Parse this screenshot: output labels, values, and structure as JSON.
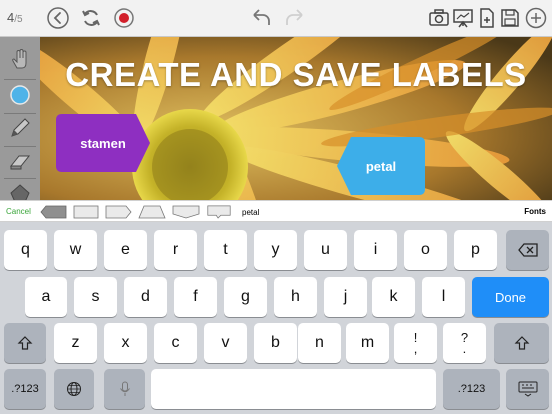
{
  "toolbar": {
    "page_current": "4",
    "page_total": "/5",
    "icons": [
      "back-circle-icon",
      "refresh-icon",
      "record-icon",
      "undo-icon",
      "redo-icon",
      "camera-icon",
      "presentation-icon",
      "export-icon",
      "save-icon",
      "add-icon"
    ]
  },
  "rail": {
    "icons": [
      "hand-icon",
      "color-dot-icon",
      "pencil-icon",
      "eraser-icon",
      "shapes-icon"
    ],
    "color": "#4fb3e8"
  },
  "canvas": {
    "headline": "CREATE AND SAVE LABELS",
    "labels": [
      {
        "text": "stamen",
        "color": "#8e2fc1"
      },
      {
        "text": "petal",
        "color": "#3daee9"
      }
    ]
  },
  "shape_strip": {
    "cancel": "Cancel",
    "input_value": "petal",
    "fonts": "Fonts",
    "accent": "#3aa53a"
  },
  "keyboard": {
    "row1": [
      "q",
      "w",
      "e",
      "r",
      "t",
      "y",
      "u",
      "i",
      "o",
      "p"
    ],
    "row2": [
      "a",
      "s",
      "d",
      "f",
      "g",
      "h",
      "j",
      "k",
      "l"
    ],
    "row3": [
      "z",
      "x",
      "c",
      "v",
      "b",
      "n",
      "m"
    ],
    "punct1": [
      "!",
      ","
    ],
    "punct2": [
      "?",
      "."
    ],
    "done": "Done",
    "numbers": ".?123",
    "numbers_right": ".?123",
    "done_color": "#1f8ef8"
  }
}
